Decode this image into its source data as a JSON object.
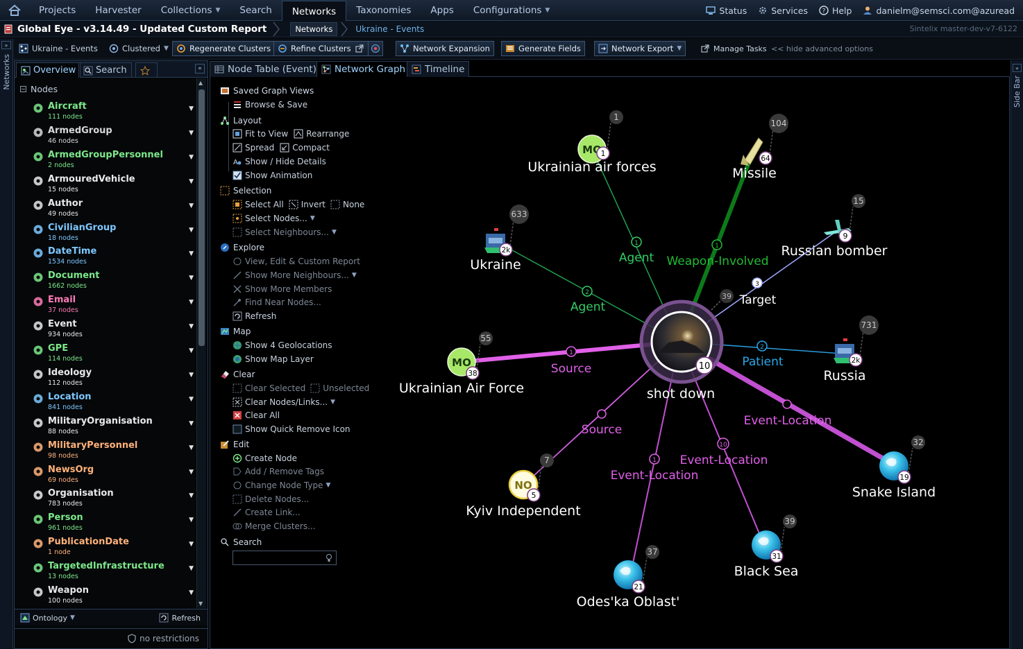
{
  "topnav": {
    "items": [
      {
        "label": "Projects",
        "caret": false,
        "active": false
      },
      {
        "label": "Harvester",
        "caret": false,
        "active": false
      },
      {
        "label": "Collections",
        "caret": true,
        "active": false
      },
      {
        "label": "Search",
        "caret": false,
        "active": false
      },
      {
        "label": "Networks",
        "caret": false,
        "active": true
      },
      {
        "label": "Taxonomies",
        "caret": false,
        "active": false
      },
      {
        "label": "Apps",
        "caret": false,
        "active": false
      },
      {
        "label": "Configurations",
        "caret": true,
        "active": false
      }
    ],
    "status": "Status",
    "services": "Services",
    "help": "Help",
    "user": "danielm@semsci.com@azuread"
  },
  "titlebar": {
    "title": "Global Eye - v3.14.49 - Updated Custom Report",
    "crumb_networks": "Networks",
    "crumb_current": "Ukraine - Events",
    "version": "Sintelix master-dev-v7-6122"
  },
  "toolbar": {
    "network_name": "Ukraine - Events",
    "clustered": "Clustered",
    "regenerate": "Regenerate Clusters",
    "refine": "Refine Clusters",
    "expansion": "Network Expansion",
    "generate": "Generate Fields",
    "export": "Network Export",
    "tasks": "Manage Tasks",
    "hide_adv": "<< hide advanced options"
  },
  "sidestrip": {
    "label": "Networks"
  },
  "rightstrip": {
    "label": "Side Bar"
  },
  "left": {
    "tabs": [
      "Overview",
      "Search"
    ],
    "nodes_header": "Nodes",
    "types": [
      {
        "name": "Aircraft",
        "count": "111 nodes",
        "color": "#7de88a",
        "icon": "aircraft-icon"
      },
      {
        "name": "ArmedGroup",
        "count": "46 nodes",
        "color": "#d8d8d8",
        "icon": "armed-group-icon"
      },
      {
        "name": "ArmedGroupPersonnel",
        "count": "2 nodes",
        "color": "#7de88a",
        "icon": "armed-group-personnel-icon"
      },
      {
        "name": "ArmouredVehicle",
        "count": "15 nodes",
        "color": "#eaeaea",
        "icon": "armoured-vehicle-icon"
      },
      {
        "name": "Author",
        "count": "49 nodes",
        "color": "#e8e8e8",
        "icon": "author-icon"
      },
      {
        "name": "CivilianGroup",
        "count": "18 nodes",
        "color": "#7ec8ff",
        "icon": "civilian-group-icon"
      },
      {
        "name": "DateTime",
        "count": "1534 nodes",
        "color": "#7ec8ff",
        "icon": "datetime-icon"
      },
      {
        "name": "Document",
        "count": "1662 nodes",
        "color": "#7de88a",
        "icon": "document-icon"
      },
      {
        "name": "Email",
        "count": "37 nodes",
        "color": "#ff7ab8",
        "icon": "email-icon"
      },
      {
        "name": "Event",
        "count": "934 nodes",
        "color": "#e8e8e8",
        "icon": "event-icon"
      },
      {
        "name": "GPE",
        "count": "114 nodes",
        "color": "#7de88a",
        "icon": "gpe-icon"
      },
      {
        "name": "Ideology",
        "count": "112 nodes",
        "color": "#e8e8e8",
        "icon": "ideology-icon"
      },
      {
        "name": "Location",
        "count": "841 nodes",
        "color": "#7ec8ff",
        "icon": "location-icon"
      },
      {
        "name": "MilitaryOrganisation",
        "count": "88 nodes",
        "color": "#eaeaea",
        "icon": "military-organisation-icon"
      },
      {
        "name": "MilitaryPersonnel",
        "count": "98 nodes",
        "color": "#ffb27a",
        "icon": "military-personnel-icon"
      },
      {
        "name": "NewsOrg",
        "count": "69 nodes",
        "color": "#ffb27a",
        "icon": "news-org-icon"
      },
      {
        "name": "Organisation",
        "count": "783 nodes",
        "color": "#eaeaea",
        "icon": "organisation-icon"
      },
      {
        "name": "Person",
        "count": "961 nodes",
        "color": "#7de88a",
        "icon": "person-icon"
      },
      {
        "name": "PublicationDate",
        "count": "1 node",
        "color": "#ffb27a",
        "icon": "publication-date-icon"
      },
      {
        "name": "TargetedInfrastructure",
        "count": "13 nodes",
        "color": "#7de88a",
        "icon": "targeted-infrastructure-icon"
      },
      {
        "name": "Weapon",
        "count": "100 nodes",
        "color": "#e8e8e8",
        "icon": "weapon-icon"
      }
    ],
    "ontology": "Ontology",
    "refresh": "Refresh",
    "restrictions": "no restrictions"
  },
  "main": {
    "tabs": [
      "Node Table (Event)",
      "Network Graph",
      "Timeline"
    ]
  },
  "menu": {
    "saved": "Saved Graph Views",
    "browse": "Browse & Save",
    "layout": "Layout",
    "fit": "Fit to View",
    "rearrange": "Rearrange",
    "spread": "Spread",
    "compact": "Compact",
    "showhide": "Show / Hide Details",
    "animation": "Show Animation",
    "selection": "Selection",
    "selectall": "Select All",
    "invert": "Invert",
    "none": "None",
    "selectnodes": "Select Nodes...",
    "selectneigh": "Select Neighbours...",
    "explore": "Explore",
    "viewedit": "View, Edit & Custom Report",
    "showmoreneigh": "Show More Neighbours...",
    "showmoremem": "Show More Members",
    "findnear": "Find Near Nodes...",
    "refresh": "Refresh",
    "map": "Map",
    "geoloc": "Show 4 Geolocations",
    "maplayer": "Show Map Layer",
    "clear": "Clear",
    "clearsel": "Clear Selected",
    "unselected": "Unselected",
    "clearnodes": "Clear Nodes/Links...",
    "clearall": "Clear All",
    "quickremove": "Show Quick Remove Icon",
    "edit": "Edit",
    "create": "Create Node",
    "addtags": "Add / Remove Tags",
    "changetype": "Change Node Type",
    "delete": "Delete Nodes...",
    "createlink": "Create Link...",
    "merge": "Merge Clusters...",
    "search": "Search"
  },
  "graph": {
    "center": {
      "label": "shot down",
      "count": "10"
    },
    "nodes": [
      {
        "id": "uaf",
        "label": "Ukrainian air forces",
        "badge": "1",
        "corner": "1",
        "kind": "mo",
        "abbr": "MO"
      },
      {
        "id": "missile",
        "label": "Missile",
        "badge": "64",
        "corner": "104",
        "kind": "missile"
      },
      {
        "id": "bomber",
        "label": "Russian bomber",
        "badge": "9",
        "corner": "15",
        "kind": "plane"
      },
      {
        "id": "ukraine",
        "label": "Ukraine",
        "badge": "2k",
        "corner": "633",
        "kind": "flag"
      },
      {
        "id": "russia",
        "label": "Russia",
        "badge": "2k",
        "corner": "731",
        "kind": "flag"
      },
      {
        "id": "uaf2",
        "label": "Ukrainian Air Force",
        "badge": "38",
        "corner": "55",
        "kind": "mo",
        "abbr": "MO"
      },
      {
        "id": "kyiv",
        "label": "Kyiv Independent",
        "badge": "5",
        "corner": "7",
        "kind": "no",
        "abbr": "NO"
      },
      {
        "id": "snake",
        "label": "Snake Island",
        "badge": "19",
        "corner": "32",
        "kind": "globe"
      },
      {
        "id": "black",
        "label": "Black Sea",
        "badge": "31",
        "corner": "39",
        "kind": "globe"
      },
      {
        "id": "odes",
        "label": "Odes'ka Oblast'",
        "badge": "21",
        "corner": "37",
        "kind": "globe"
      }
    ],
    "center_corner": "39",
    "links": [
      {
        "id": "l1",
        "label": "Agent",
        "badge": "1",
        "color": "#33cc66"
      },
      {
        "id": "l2",
        "label": "Weapon-Involved",
        "badge": "1",
        "color": "#22bb33"
      },
      {
        "id": "l3",
        "label": "Target",
        "badge": "3",
        "color": "#9ea8ff"
      },
      {
        "id": "l4",
        "label": "Agent",
        "badge": "2",
        "color": "#33cc66"
      },
      {
        "id": "l5",
        "label": "Patient",
        "badge": "2",
        "color": "#2aa8e8"
      },
      {
        "id": "l6",
        "label": "Source",
        "badge": "1",
        "color": "#e060e8"
      },
      {
        "id": "l7",
        "label": "Event-Location",
        "badge": "",
        "color": "#e060e8"
      },
      {
        "id": "l8",
        "label": "Source",
        "badge": "",
        "color": "#e060e8"
      },
      {
        "id": "l9",
        "label": "Event-Location",
        "badge": "10",
        "color": "#e060e8"
      },
      {
        "id": "l10",
        "label": "Event-Location",
        "badge": "1",
        "color": "#e060e8"
      }
    ]
  }
}
